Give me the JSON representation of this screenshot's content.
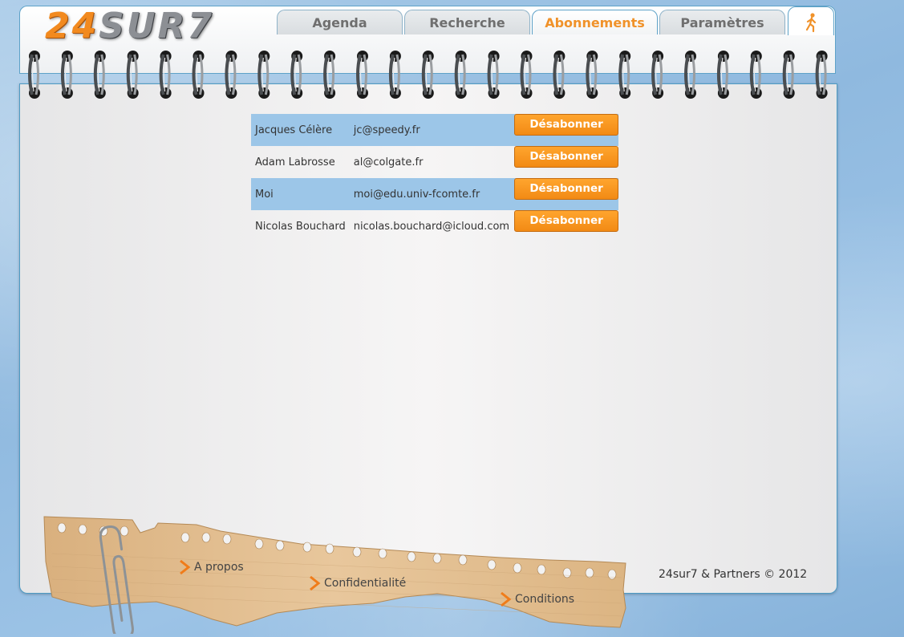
{
  "header": {
    "logo_num": "24",
    "logo_text": "SUR7",
    "tabs": [
      {
        "label": "Agenda",
        "active": false
      },
      {
        "label": "Recherche",
        "active": false
      },
      {
        "label": "Abonnements",
        "active": true
      },
      {
        "label": "Paramètres",
        "active": false
      }
    ],
    "exit_icon": "walking-person-icon"
  },
  "subscriptions": {
    "button_label": "Désabonner",
    "rows": [
      {
        "name": "Jacques Célère",
        "email": "jc@speedy.fr"
      },
      {
        "name": "Adam Labrosse",
        "email": "al@colgate.fr"
      },
      {
        "name": "Moi",
        "email": "moi@edu.univ-fcomte.fr"
      },
      {
        "name": "Nicolas Bouchard",
        "email": "nicolas.bouchard@icloud.com"
      }
    ]
  },
  "footer": {
    "links": [
      {
        "label": "A propos"
      },
      {
        "label": "Confidentialité"
      },
      {
        "label": "Conditions"
      }
    ],
    "copyright": "24sur7 & Partners © 2012"
  },
  "colors": {
    "accent": "#f0922a",
    "row_highlight": "#9cc6e8",
    "button": "#f28a15",
    "border": "#4e9bc4"
  }
}
